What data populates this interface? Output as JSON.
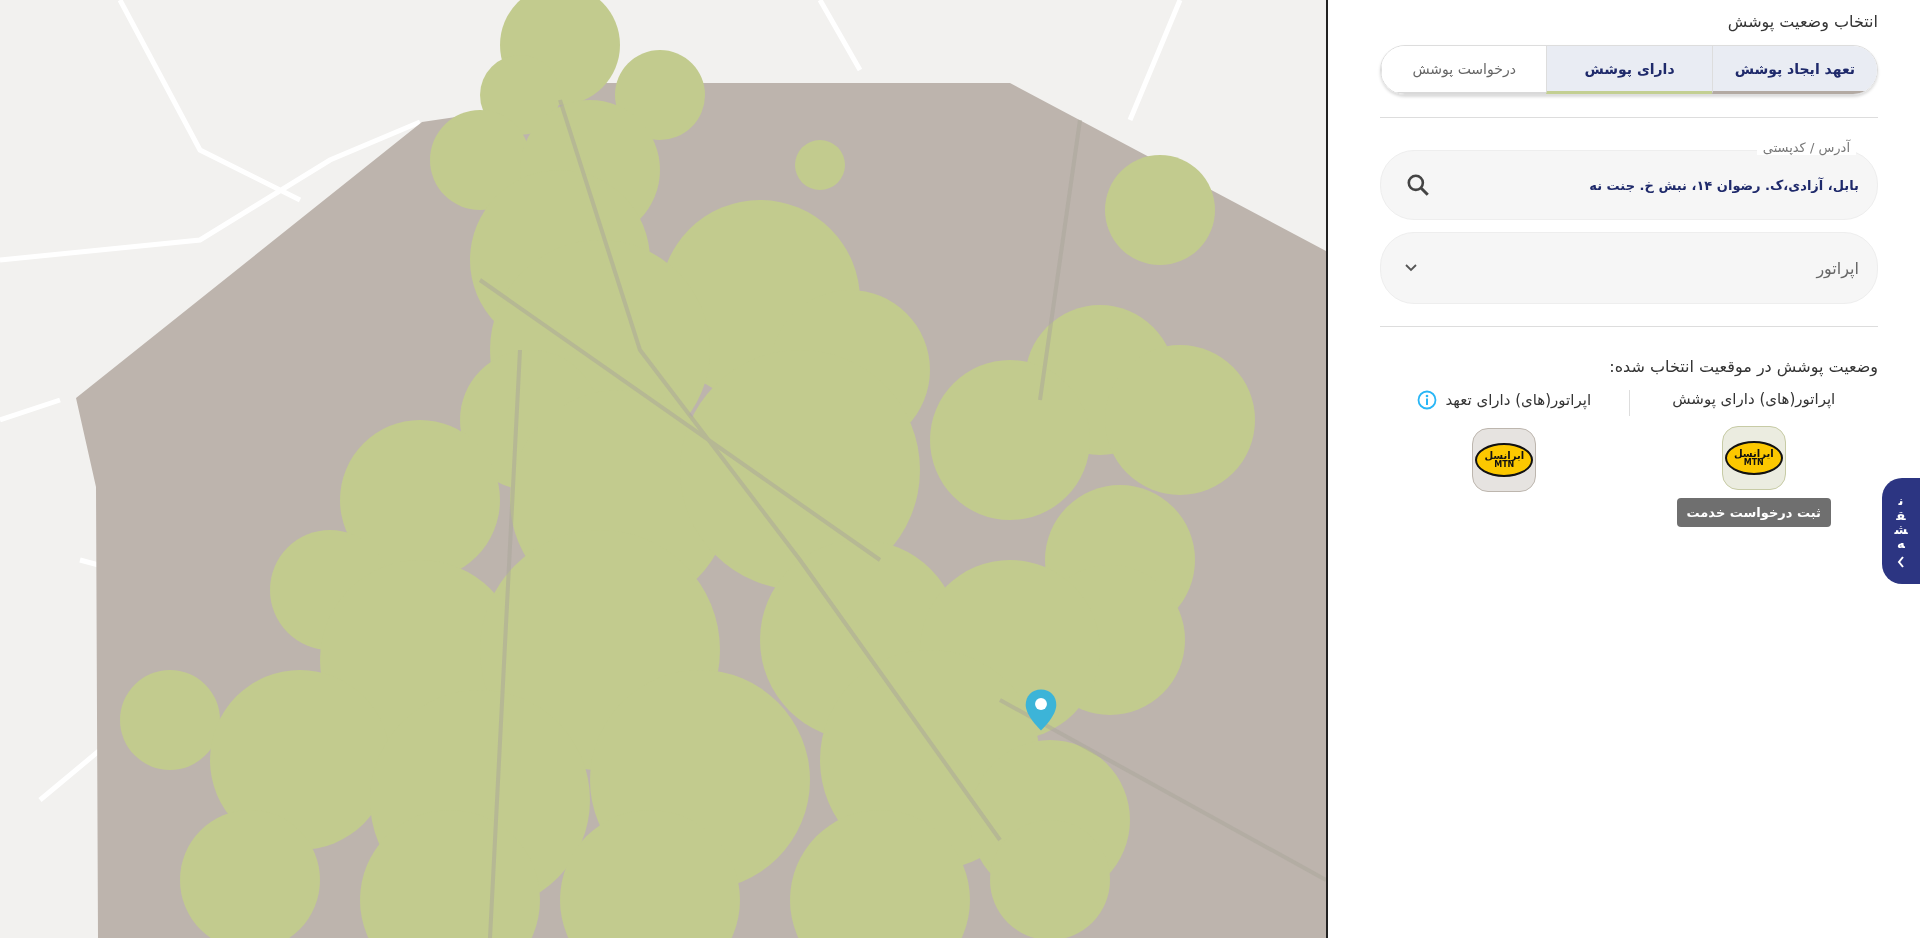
{
  "panel": {
    "title": "انتخاب وضعیت پوشش",
    "tabs": [
      {
        "label": "تعهد ایجاد پوشش",
        "selected": true,
        "color": "#b3aaa3"
      },
      {
        "label": "دارای پوشش",
        "selected": true,
        "color": "#c3cf92"
      },
      {
        "label": "درخواست پوشش",
        "selected": false,
        "color": "#d9d9d9"
      }
    ],
    "address": {
      "label": "آدرس / کدپستی",
      "value": "بابل، آزادی،ک. رضوان ۱۴، نبش خ. جنت نه"
    },
    "operator_select": {
      "placeholder": "اپراتور"
    },
    "result_title": "وضعیت پوشش در موقعیت انتخاب شده:",
    "columns": [
      {
        "title": "اپراتور(های) دارای پوشش",
        "kind": "coverage",
        "operators": [
          {
            "logo_text": "ایرانسل",
            "logo_subtext": "MTN",
            "tooltip": "ثبت درخواست خدمت"
          }
        ]
      },
      {
        "title": "اپراتور(های) دارای تعهد",
        "kind": "commitment",
        "operators": [
          {
            "logo_text": "ایرانسل",
            "logo_subtext": "MTN"
          }
        ]
      }
    ]
  },
  "map_toggle": {
    "label": "نقشه"
  }
}
